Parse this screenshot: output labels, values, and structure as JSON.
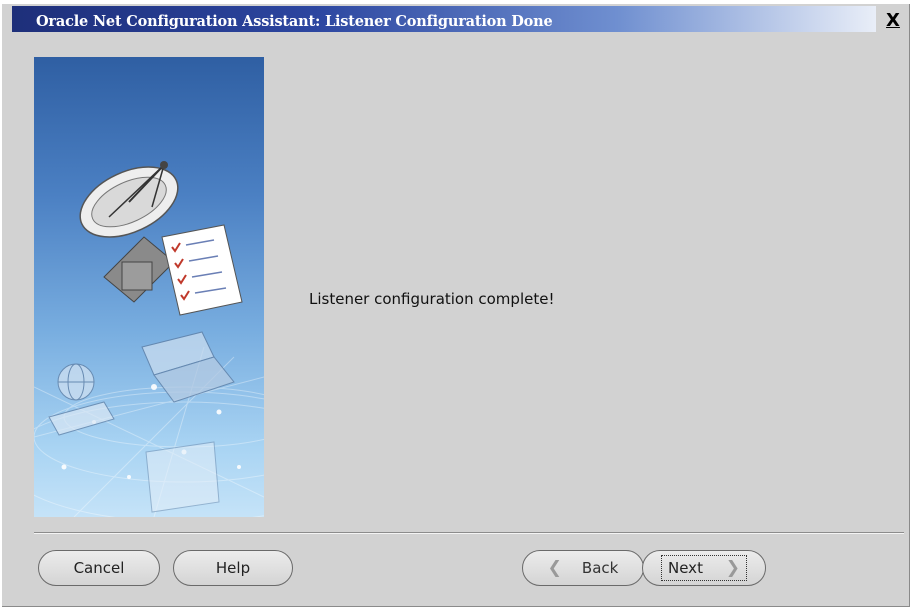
{
  "window": {
    "title": "Oracle Net Configuration Assistant: Listener Configuration Done",
    "close_label": "X"
  },
  "content": {
    "message": "Listener configuration complete!"
  },
  "buttons": {
    "cancel": "Cancel",
    "help": "Help",
    "back": "Back",
    "next": "Next",
    "back_icon": "chevron-left-icon",
    "next_icon": "chevron-right-icon"
  },
  "colors": {
    "title_bar_start": "#1e2f7a",
    "window_bg": "#d2d2d2",
    "sidebar_top": "#2f5fa3",
    "sidebar_bottom": "#c5e3f8"
  }
}
